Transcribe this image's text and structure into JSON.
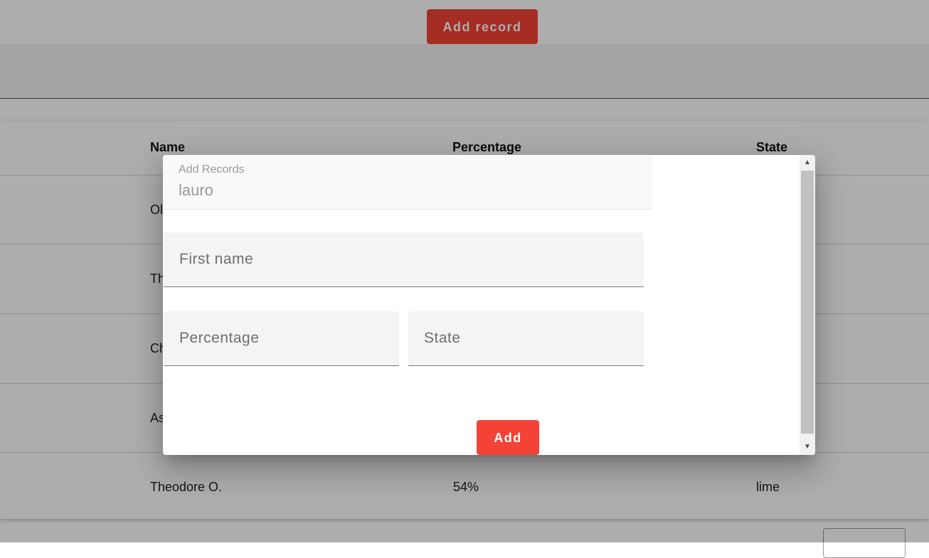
{
  "toolbar": {
    "add_record_label": "Add record"
  },
  "table": {
    "columns": [
      "Name",
      "Percentage",
      "State"
    ],
    "rows": [
      {
        "name": "Ol",
        "percentage": "",
        "state": ""
      },
      {
        "name": "Th",
        "percentage": "",
        "state": ""
      },
      {
        "name": "Ch",
        "percentage": "",
        "state": ""
      },
      {
        "name": "As",
        "percentage": "",
        "state": ""
      },
      {
        "name": "Theodore O.",
        "percentage": "54%",
        "state": "lime"
      }
    ]
  },
  "dialog": {
    "header_label": "Add Records",
    "header_value": "lauro",
    "first_name_placeholder": "First name",
    "percentage_placeholder": "Percentage",
    "state_placeholder": "State",
    "add_label": "Add"
  },
  "colors": {
    "accent": "#f44336"
  },
  "icons": {
    "scroll_up": "triangle-up-icon",
    "scroll_down": "triangle-down-icon"
  }
}
